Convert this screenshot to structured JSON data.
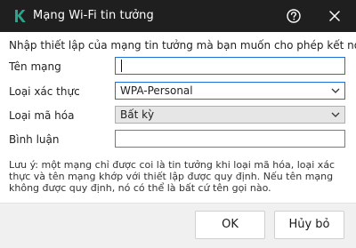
{
  "window": {
    "title": "Mạng Wi-Fi tin tưởng",
    "help_icon": "help-circle-icon",
    "close_icon": "close-icon",
    "logo_icon": "kaspersky-k-logo"
  },
  "form": {
    "intro": "Nhập thiết lập của mạng tin tưởng mà bạn muốn cho phép kết nối.",
    "network_name": {
      "label": "Tên mạng",
      "value": ""
    },
    "auth_type": {
      "label": "Loại xác thực",
      "value": "WPA-Personal"
    },
    "encryption_type": {
      "label": "Loại mã hóa",
      "value": "Bất kỳ"
    },
    "comment": {
      "label": "Bình luận",
      "value": ""
    }
  },
  "note": "Lưu ý: một mạng chỉ được coi là tin tưởng khi loại mã hóa, loại xác thực và tên mạng khớp với thiết lập được quy định. Nếu tên mạng không được quy định, nó có thể là bất cứ tên gọi nào.",
  "buttons": {
    "ok": "OK",
    "cancel": "Hủy bỏ"
  },
  "colors": {
    "titlebar": "#1f1f1f",
    "logo_green": "#29a58a",
    "focus_border": "#1e6fd9",
    "footer": "#f0f0f0"
  }
}
